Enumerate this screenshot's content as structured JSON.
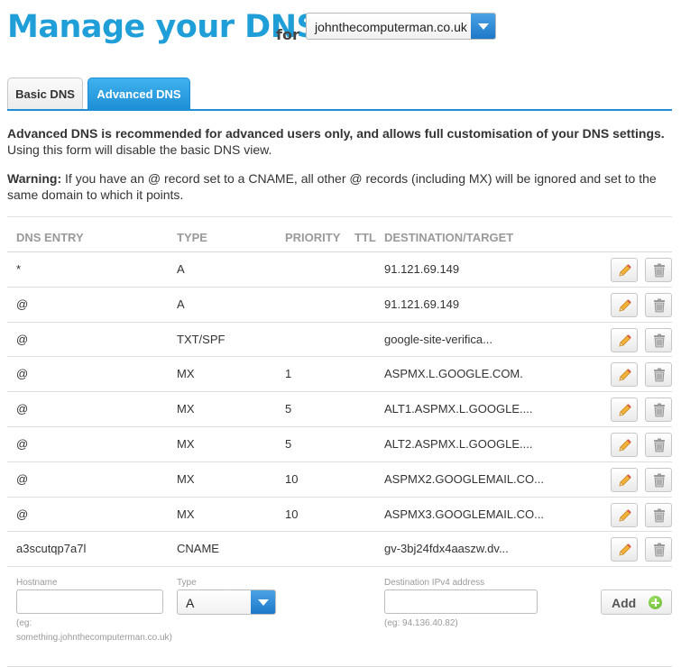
{
  "header": {
    "title": "Manage your DNS",
    "for_label": "for",
    "domain_selected": "johnthecomputerman.co.uk"
  },
  "tabs": [
    {
      "label": "Basic DNS",
      "active": false
    },
    {
      "label": "Advanced DNS",
      "active": true
    }
  ],
  "intro": {
    "bold": "Advanced DNS is recommended for advanced users only, and allows full customisation of your DNS settings.",
    "normal": " Using this form will disable the basic DNS view."
  },
  "warning": {
    "label": "Warning:",
    "text": " If you have an @ record set to a CNAME, all other @ records (including MX) will be ignored and set to the same domain to which it points."
  },
  "table": {
    "headers": {
      "entry": "DNS ENTRY",
      "type": "TYPE",
      "priority": "PRIORITY",
      "ttl": "TTL",
      "destination": "DESTINATION/TARGET"
    },
    "rows": [
      {
        "entry": "*",
        "type": "A",
        "priority": "",
        "ttl": "",
        "destination": "91.121.69.149"
      },
      {
        "entry": "@",
        "type": "A",
        "priority": "",
        "ttl": "",
        "destination": "91.121.69.149"
      },
      {
        "entry": "@",
        "type": "TXT/SPF",
        "priority": "",
        "ttl": "",
        "destination": "google-site-verifica..."
      },
      {
        "entry": "@",
        "type": "MX",
        "priority": "1",
        "ttl": "",
        "destination": "ASPMX.L.GOOGLE.COM."
      },
      {
        "entry": "@",
        "type": "MX",
        "priority": "5",
        "ttl": "",
        "destination": "ALT1.ASPMX.L.GOOGLE...."
      },
      {
        "entry": "@",
        "type": "MX",
        "priority": "5",
        "ttl": "",
        "destination": "ALT2.ASPMX.L.GOOGLE...."
      },
      {
        "entry": "@",
        "type": "MX",
        "priority": "10",
        "ttl": "",
        "destination": "ASPMX2.GOOGLEMAIL.CO..."
      },
      {
        "entry": "@",
        "type": "MX",
        "priority": "10",
        "ttl": "",
        "destination": "ASPMX3.GOOGLEMAIL.CO..."
      },
      {
        "entry": "a3scutqp7a7l",
        "type": "CNAME",
        "priority": "",
        "ttl": "",
        "destination": "gv-3bj24fdx4aaszw.dv..."
      }
    ]
  },
  "add_form": {
    "hostname_label": "Hostname",
    "hostname_value": "",
    "hostname_hint": "(eg: something.johnthecomputerman.co.uk)",
    "type_label": "Type",
    "type_selected": "A",
    "dest_label": "Destination IPv4 address",
    "dest_value": "",
    "dest_hint": "(eg: 94.136.40.82)",
    "add_label": "Add"
  },
  "icons": {
    "edit": "pencil-icon",
    "delete": "trash-icon",
    "add": "plus-circle-icon",
    "dropdown": "chevron-down-icon"
  },
  "colors": {
    "brand_blue": "#1f9ed8",
    "tab_active": "#1e8fd6",
    "add_green": "#5fb52a"
  }
}
